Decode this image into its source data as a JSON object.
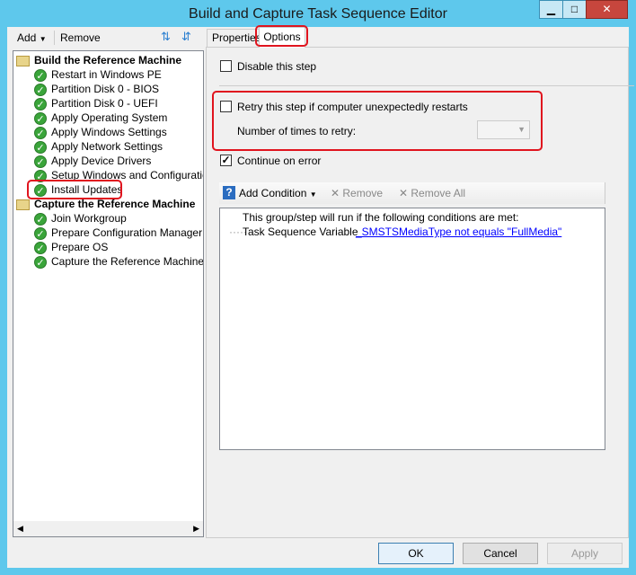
{
  "window": {
    "title": "Build and Capture Task Sequence Editor",
    "minimize": "▁",
    "maximize": "□",
    "close": "✕"
  },
  "toolbar": {
    "add": "Add",
    "remove": "Remove"
  },
  "tree": {
    "groups": [
      {
        "label": "Build the Reference Machine",
        "items": [
          "Restart in Windows PE",
          "Partition Disk 0 - BIOS",
          "Partition Disk 0 - UEFI",
          "Apply Operating System",
          "Apply Windows Settings",
          "Apply Network Settings",
          "Apply Device Drivers",
          "Setup Windows and Configuration",
          "Install Updates"
        ]
      },
      {
        "label": "Capture the Reference Machine",
        "items": [
          "Join Workgroup",
          "Prepare Configuration Manager Cli",
          "Prepare OS",
          "Capture the Reference Machine"
        ]
      }
    ],
    "selected": "Install Updates"
  },
  "tabs": [
    {
      "label": "Properties"
    },
    {
      "label": "Options",
      "active": true
    }
  ],
  "options": {
    "disable_step": {
      "label": "Disable this step",
      "checked": false
    },
    "retry": {
      "label": "Retry this step if computer unexpectedly restarts",
      "checked": false
    },
    "retry_count_label": "Number of times to retry:",
    "retry_count_value": "",
    "continue_on_error": {
      "label": "Continue on error",
      "checked": true
    },
    "conditions_toolbar": {
      "add": "Add Condition",
      "remove": "Remove",
      "remove_all": "Remove All"
    },
    "conditions_header": "This group/step will run if the following conditions are met:",
    "condition": {
      "type": "Task Sequence Variable",
      "expr": "_SMSTSMediaType not equals \"FullMedia\""
    }
  },
  "buttons": {
    "ok": "OK",
    "cancel": "Cancel",
    "apply": "Apply"
  },
  "colors": {
    "title_bar": "#5ec8ec",
    "highlight": "#e0141e",
    "link": "#0000ff"
  }
}
